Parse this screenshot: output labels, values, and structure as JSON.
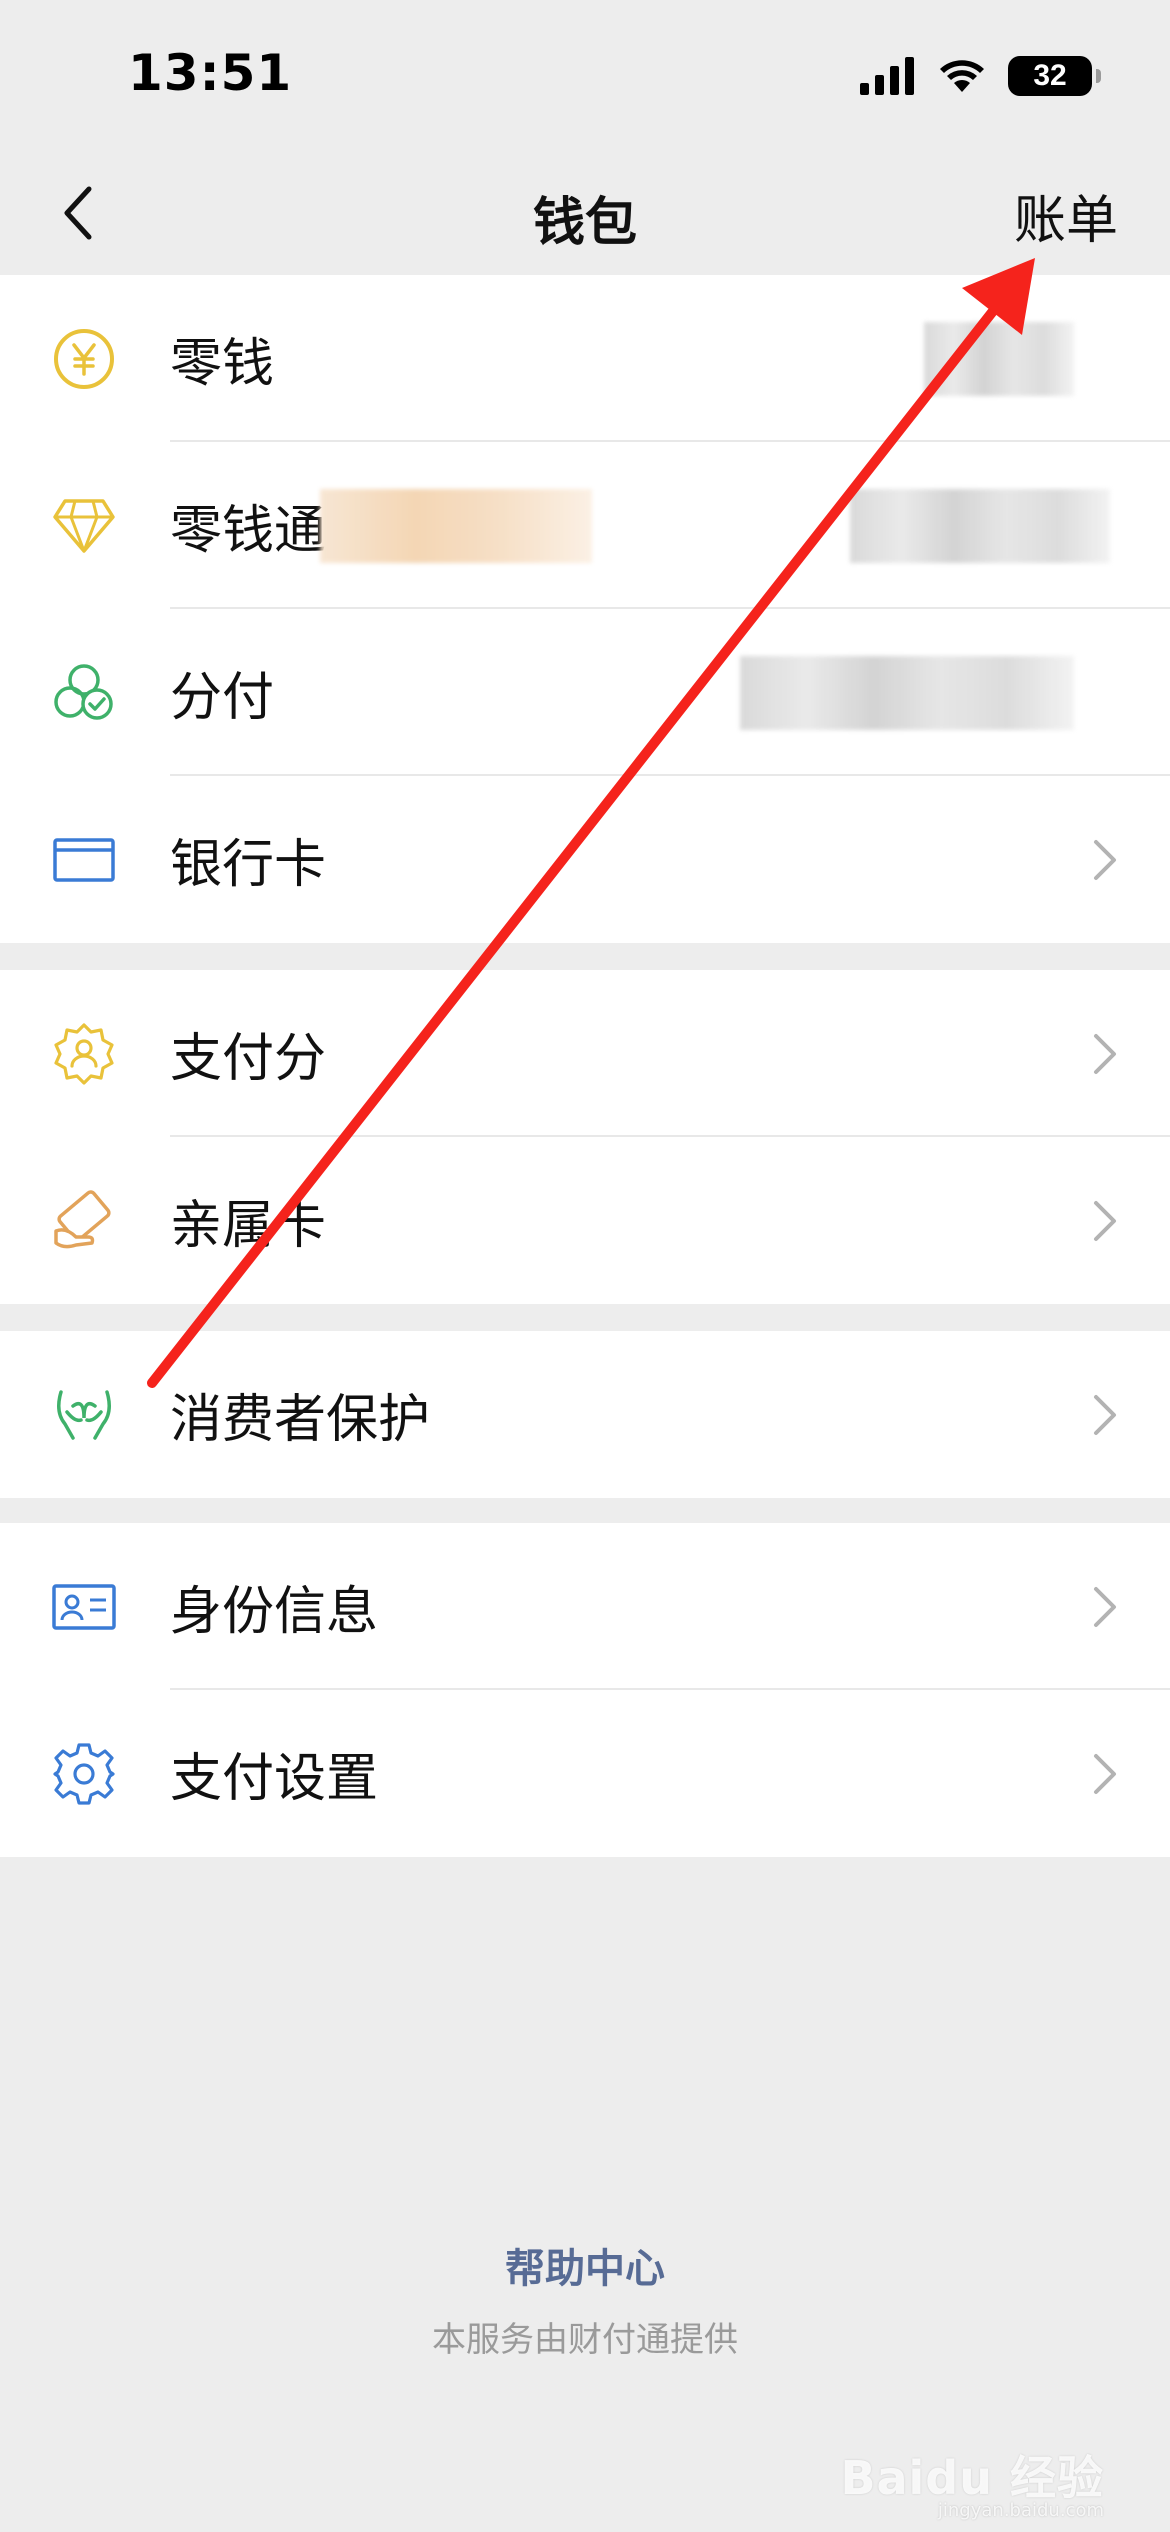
{
  "status_bar": {
    "time": "13:51",
    "battery": "32"
  },
  "nav": {
    "title": "钱包",
    "action": "账单"
  },
  "groups": [
    [
      {
        "label": "零钱",
        "icon": "yuan-coin-icon",
        "trailing": "blurred-value"
      },
      {
        "label": "零钱通",
        "icon": "diamond-icon",
        "trailing": "blurred-value"
      },
      {
        "label": "分付",
        "icon": "fenfu-clover-icon",
        "trailing": "blurred-value"
      },
      {
        "label": "银行卡",
        "icon": "bank-card-icon",
        "trailing": "chevron"
      }
    ],
    [
      {
        "label": "支付分",
        "icon": "payment-score-badge-icon",
        "trailing": "chevron"
      },
      {
        "label": "亲属卡",
        "icon": "family-card-icon",
        "trailing": "chevron"
      }
    ],
    [
      {
        "label": "消费者保护",
        "icon": "hands-protection-icon",
        "trailing": "chevron"
      }
    ],
    [
      {
        "label": "身份信息",
        "icon": "id-card-icon",
        "trailing": "chevron"
      },
      {
        "label": "支付设置",
        "icon": "settings-gear-icon",
        "trailing": "chevron"
      }
    ]
  ],
  "footer": {
    "help_link": "帮助中心",
    "provider_note": "本服务由财付通提供"
  },
  "watermark": {
    "brand": "Baidu 经验",
    "url": "jingyan.baidu.com"
  },
  "colors": {
    "link": "#576b95",
    "annotation_arrow": "#f5231c",
    "icon_yellow": "#e9c23a",
    "icon_green": "#3fb16a",
    "icon_blue": "#3a7bd5",
    "icon_orange": "#e2a35a"
  }
}
